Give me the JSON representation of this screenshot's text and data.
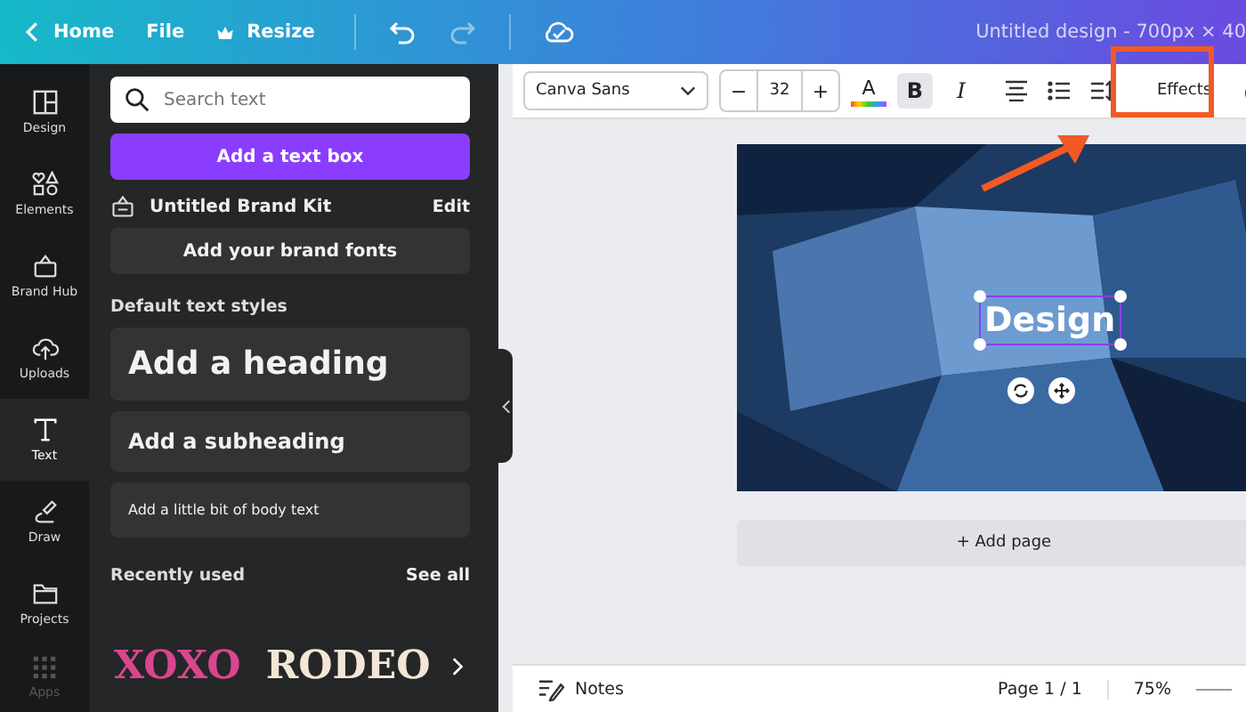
{
  "top_bar": {
    "home": "Home",
    "file": "File",
    "resize": "Resize",
    "title": "Untitled design - 700px × 40"
  },
  "rail": {
    "items": [
      {
        "label": "Design",
        "kind": "design",
        "selected": false
      },
      {
        "label": "Elements",
        "kind": "elements",
        "selected": false
      },
      {
        "label": "Brand Hub",
        "kind": "brand",
        "selected": false
      },
      {
        "label": "Uploads",
        "kind": "uploads",
        "selected": false
      },
      {
        "label": "Text",
        "kind": "text",
        "selected": true
      },
      {
        "label": "Draw",
        "kind": "draw",
        "selected": false
      },
      {
        "label": "Projects",
        "kind": "projects",
        "selected": false
      },
      {
        "label": "Apps",
        "kind": "apps",
        "selected": false
      }
    ]
  },
  "panel": {
    "search": {
      "placeholder": "Search text"
    },
    "add_text_box": "Add a text box",
    "brand_kit": {
      "name": "Untitled Brand Kit",
      "edit": "Edit"
    },
    "brand_fonts": "Add your brand fonts",
    "styles_title": "Default text styles",
    "styles": [
      {
        "kind": "heading",
        "label": "Add a heading"
      },
      {
        "kind": "subheading",
        "label": "Add a subheading"
      },
      {
        "kind": "body",
        "label": "Add a little bit of body text"
      }
    ],
    "recent": {
      "title": "Recently used",
      "see_all": "See all",
      "fonts": [
        {
          "label": "XOXO",
          "color": "#d9468f"
        },
        {
          "label": "RODEO",
          "color": "#f3e6d6"
        }
      ]
    }
  },
  "toolbar": {
    "font": "Canva Sans",
    "minus": "−",
    "size": "32",
    "plus": "+",
    "color_letter": "A",
    "bold": {
      "label": "B",
      "selected": true
    },
    "italic": {
      "label": "I",
      "selected": false
    },
    "effects": "Effects"
  },
  "canvas": {
    "text": "Design",
    "text_selected": true,
    "add_page": "+ Add page"
  },
  "status_bar": {
    "notes": "Notes",
    "page": "Page 1 / 1",
    "zoom": "75%"
  }
}
